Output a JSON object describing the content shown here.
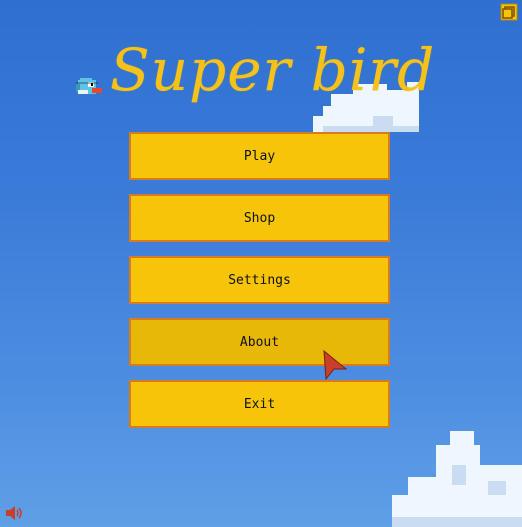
{
  "title": "Super bird",
  "menu": {
    "play": "Play",
    "shop": "Shop",
    "settings": "Settings",
    "about": "About",
    "exit": "Exit"
  },
  "hovered_item": "About",
  "icons": {
    "fullscreen": "fullscreen-icon",
    "sound": "speaker-icon",
    "bird": "bird-icon"
  },
  "colors": {
    "sky": "#3a7ad8",
    "button_fill": "#f6c50a",
    "button_border": "#d97a1e",
    "title": "#f4c21b",
    "cursor": "#c8402a"
  }
}
